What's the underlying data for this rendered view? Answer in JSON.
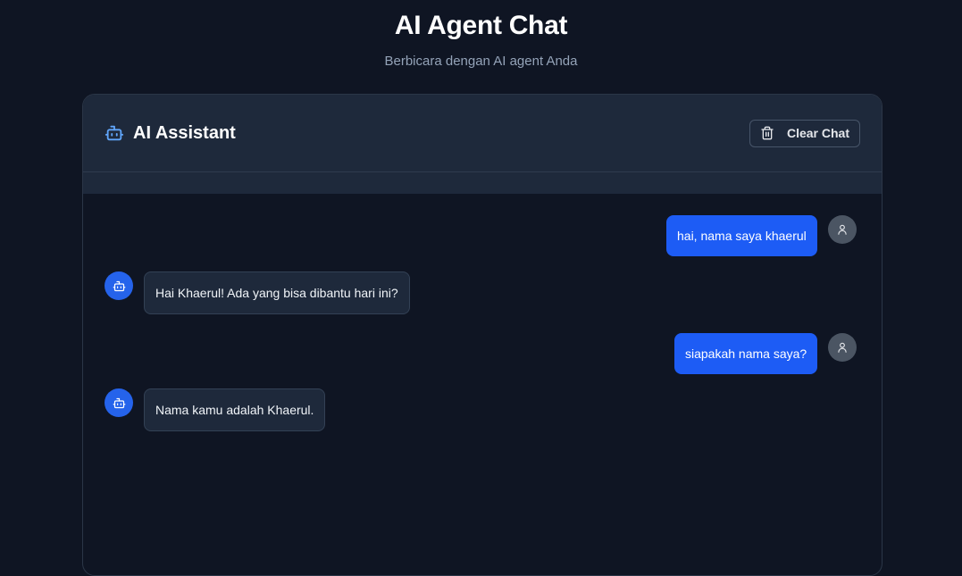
{
  "page": {
    "title": "AI Agent Chat",
    "subtitle": "Berbicara dengan AI agent Anda"
  },
  "chat": {
    "assistant_title": "AI Assistant",
    "clear_label": "Clear Chat",
    "messages": [
      {
        "role": "user",
        "text": "hai, nama saya khaerul"
      },
      {
        "role": "assistant",
        "text": "Hai Khaerul! Ada yang bisa dibantu hari ini?"
      },
      {
        "role": "user",
        "text": "siapakah nama saya?"
      },
      {
        "role": "assistant",
        "text": "Nama kamu adalah Khaerul."
      }
    ]
  },
  "colors": {
    "background": "#0f1523",
    "panel": "#1e293b",
    "accent": "#1d5cf5",
    "bot_icon": "#60a5fa"
  },
  "icons": {
    "header": "robot-icon",
    "clear": "trash-icon",
    "user_avatar": "user-icon",
    "bot_avatar": "robot-icon"
  }
}
